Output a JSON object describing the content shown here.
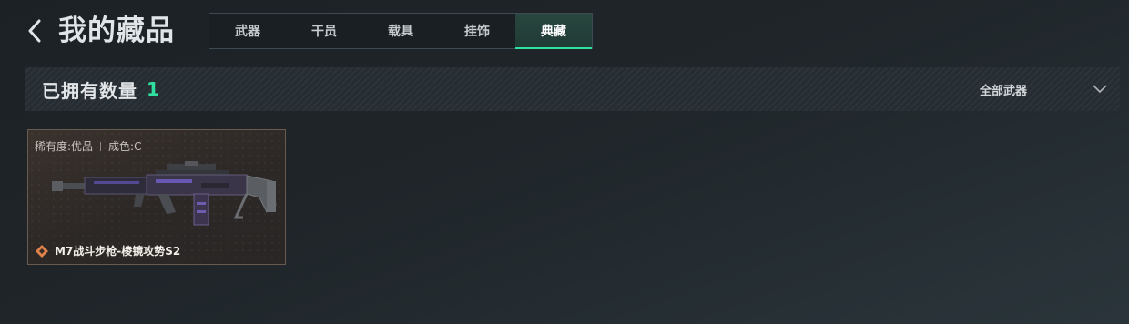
{
  "header": {
    "title": "我的藏品"
  },
  "tabs": [
    {
      "label": "武器",
      "active": false
    },
    {
      "label": "干员",
      "active": false
    },
    {
      "label": "载具",
      "active": false
    },
    {
      "label": "挂饰",
      "active": false
    },
    {
      "label": "典藏",
      "active": true
    }
  ],
  "summary": {
    "count_label": "已拥有数量",
    "count_value": "1",
    "filter_label": "全部武器"
  },
  "items": [
    {
      "rarity": "稀有度:优品",
      "wear": "成色:C",
      "name": "M7战斗步枪-棱镜攻势S2"
    }
  ],
  "colors": {
    "accent": "#2fe0a0",
    "card_border": "#6a5b50",
    "rarity_icon": "#e0834a"
  },
  "icons": {
    "back": "chevron-left-icon",
    "dropdown": "chevron-down-icon",
    "rarity": "diamond-icon"
  }
}
